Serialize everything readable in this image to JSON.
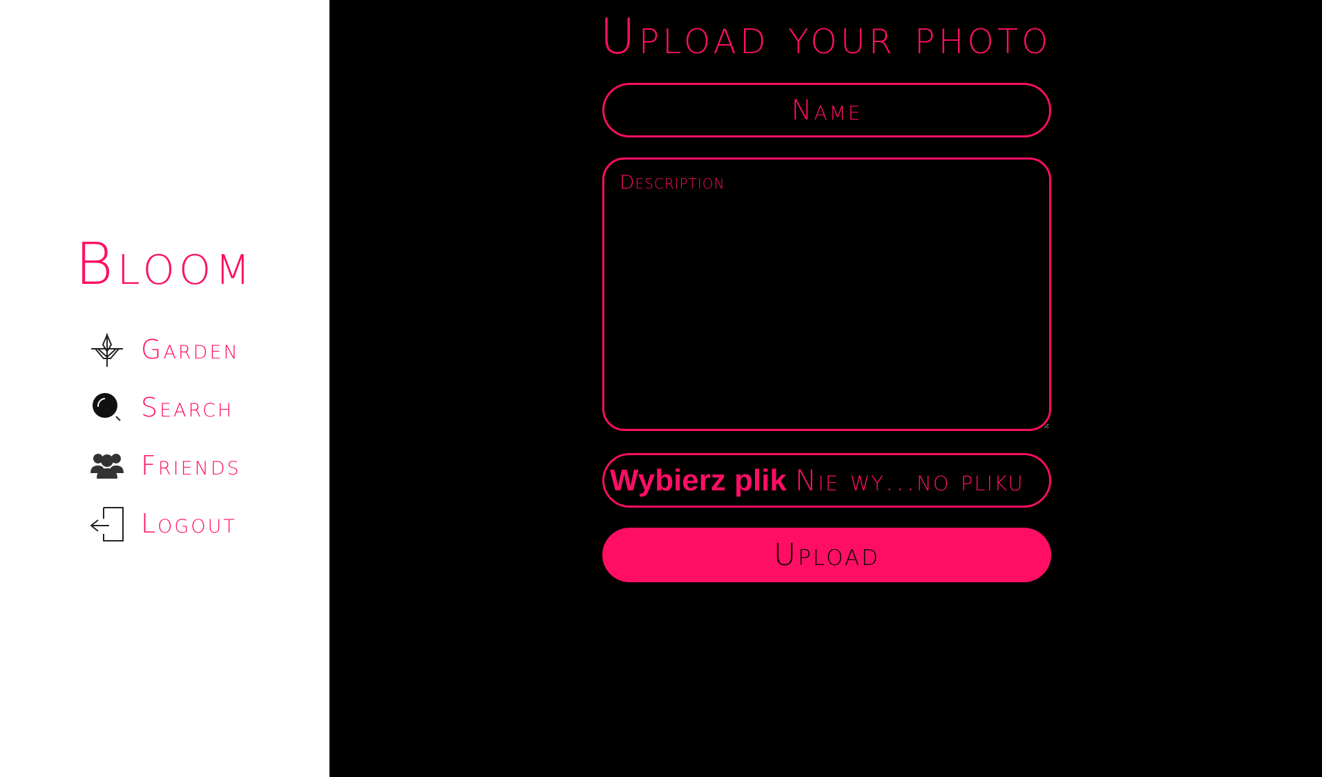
{
  "colors": {
    "accent": "#ff0e64",
    "sidebar_bg": "#ffffff",
    "main_bg": "#000000",
    "icon": "#222222"
  },
  "sidebar": {
    "brand": "Bloom",
    "items": [
      {
        "label": "Garden",
        "icon": "plant-icon"
      },
      {
        "label": "Search",
        "icon": "search-icon"
      },
      {
        "label": "Friends",
        "icon": "friends-icon"
      },
      {
        "label": "Logout",
        "icon": "logout-icon"
      }
    ]
  },
  "main": {
    "title": "Upload your photo",
    "form": {
      "name_placeholder": "Name",
      "description_placeholder": "Description",
      "file_button_label": "Wybierz plik",
      "file_status": "Nie wy...no pliku",
      "upload_label": "Upload"
    }
  }
}
